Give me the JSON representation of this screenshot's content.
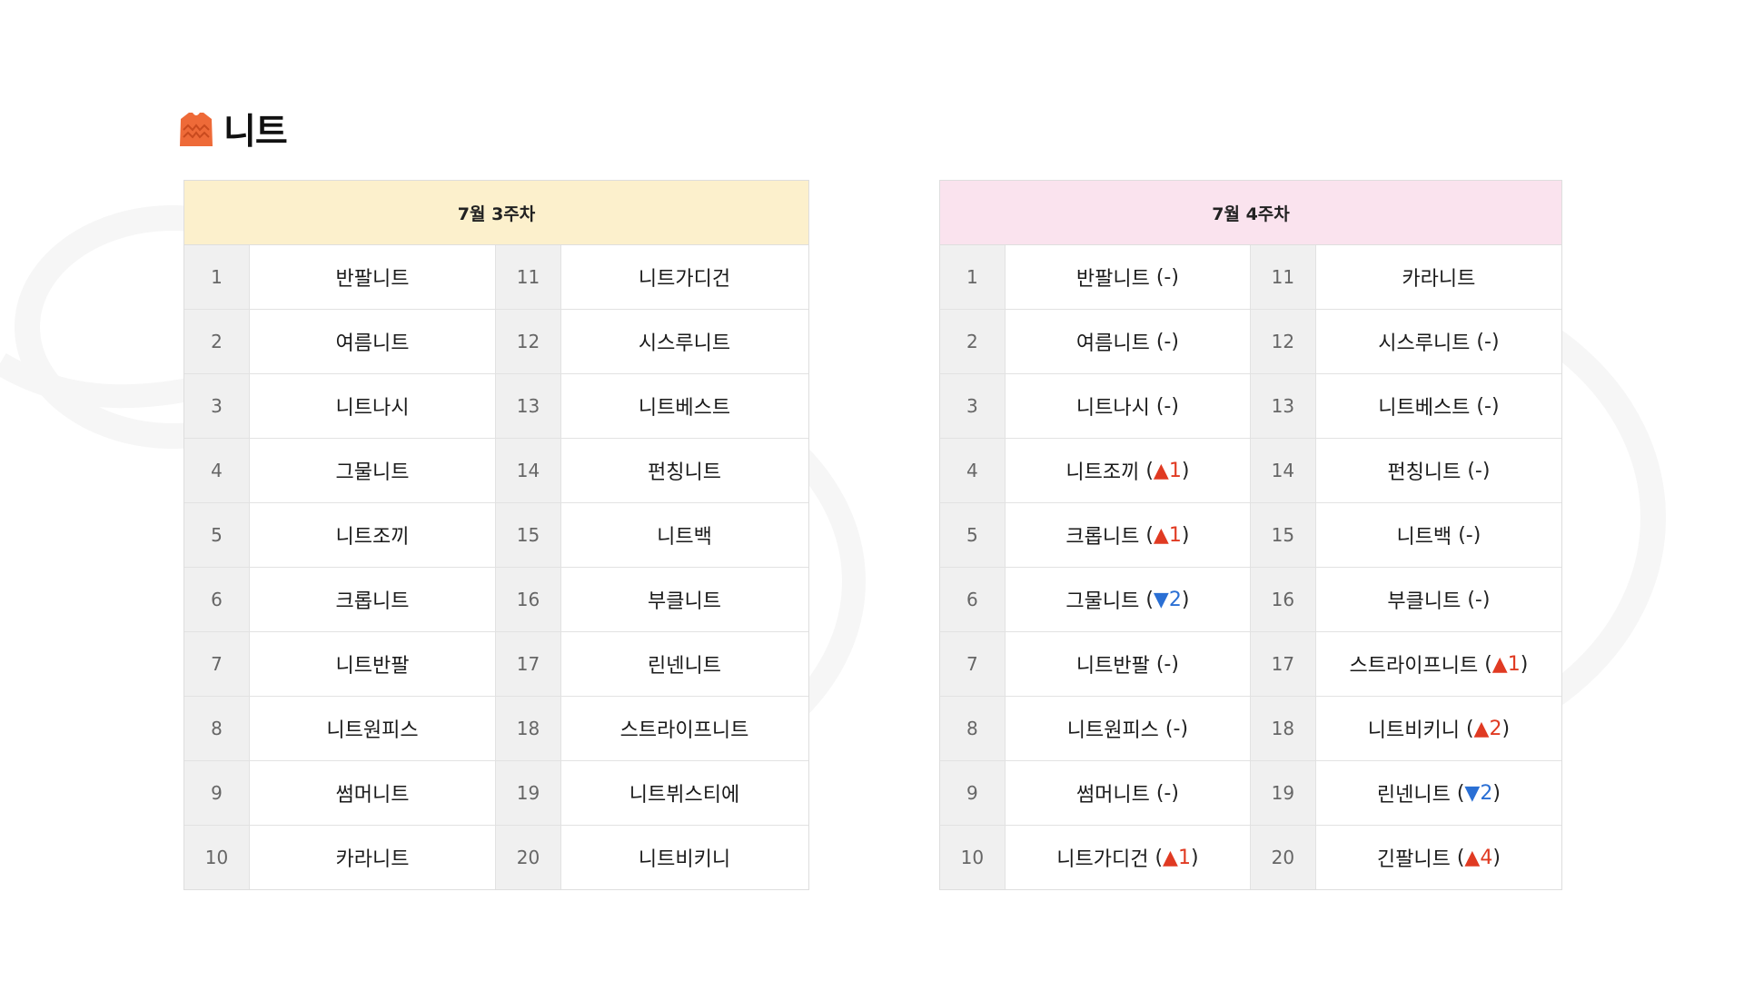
{
  "title": "니트",
  "icon": "sweater-icon",
  "colors": {
    "week1_header": "#fcf0cc",
    "week2_header": "#fae3ee",
    "up": "#e03a22",
    "down": "#2a6fd4",
    "icon": "#ee6a38"
  },
  "week1": {
    "header": "7월 3주차",
    "rows": [
      {
        "rank_a": "1",
        "item_a": "반팔니트",
        "rank_b": "11",
        "item_b": "니트가디건"
      },
      {
        "rank_a": "2",
        "item_a": "여름니트",
        "rank_b": "12",
        "item_b": "시스루니트"
      },
      {
        "rank_a": "3",
        "item_a": "니트나시",
        "rank_b": "13",
        "item_b": "니트베스트"
      },
      {
        "rank_a": "4",
        "item_a": "그물니트",
        "rank_b": "14",
        "item_b": "펀칭니트"
      },
      {
        "rank_a": "5",
        "item_a": "니트조끼",
        "rank_b": "15",
        "item_b": "니트백"
      },
      {
        "rank_a": "6",
        "item_a": "크롭니트",
        "rank_b": "16",
        "item_b": "부클니트"
      },
      {
        "rank_a": "7",
        "item_a": "니트반팔",
        "rank_b": "17",
        "item_b": "린넨니트"
      },
      {
        "rank_a": "8",
        "item_a": "니트원피스",
        "rank_b": "18",
        "item_b": "스트라이프니트"
      },
      {
        "rank_a": "9",
        "item_a": "썸머니트",
        "rank_b": "19",
        "item_b": "니트뷔스티에"
      },
      {
        "rank_a": "10",
        "item_a": "카라니트",
        "rank_b": "20",
        "item_b": "니트비키니"
      }
    ]
  },
  "week2": {
    "header": "7월 4주차",
    "rows": [
      {
        "rank_a": "1",
        "item_a": "반팔니트",
        "change_a": "-",
        "rank_b": "11",
        "item_b": "카라니트",
        "change_b": ""
      },
      {
        "rank_a": "2",
        "item_a": "여름니트",
        "change_a": "-",
        "rank_b": "12",
        "item_b": "시스루니트",
        "change_b": "-"
      },
      {
        "rank_a": "3",
        "item_a": "니트나시",
        "change_a": "-",
        "rank_b": "13",
        "item_b": "니트베스트",
        "change_b": "-"
      },
      {
        "rank_a": "4",
        "item_a": "니트조끼",
        "change_a": "▲1",
        "rank_b": "14",
        "item_b": "펀칭니트",
        "change_b": "-"
      },
      {
        "rank_a": "5",
        "item_a": "크롭니트",
        "change_a": "▲1",
        "rank_b": "15",
        "item_b": "니트백",
        "change_b": "-"
      },
      {
        "rank_a": "6",
        "item_a": "그물니트",
        "change_a": "▼2",
        "rank_b": "16",
        "item_b": "부클니트",
        "change_b": "-"
      },
      {
        "rank_a": "7",
        "item_a": "니트반팔",
        "change_a": "-",
        "rank_b": "17",
        "item_b": "스트라이프니트",
        "change_b": "▲1"
      },
      {
        "rank_a": "8",
        "item_a": "니트원피스",
        "change_a": "-",
        "rank_b": "18",
        "item_b": "니트비키니",
        "change_b": "▲2"
      },
      {
        "rank_a": "9",
        "item_a": "썸머니트",
        "change_a": "-",
        "rank_b": "19",
        "item_b": "린넨니트",
        "change_b": "▼2"
      },
      {
        "rank_a": "10",
        "item_a": "니트가디건",
        "change_a": "▲1",
        "rank_b": "20",
        "item_b": "긴팔니트",
        "change_b": "▲4"
      }
    ]
  }
}
